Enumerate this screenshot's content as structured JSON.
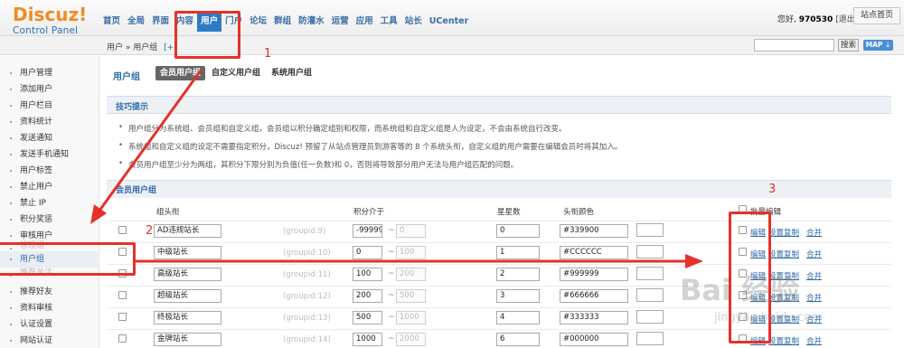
{
  "logo": {
    "title": "Discuz!",
    "subtitle": "Control Panel"
  },
  "nav": [
    "首页",
    "全局",
    "界面",
    "内容",
    "用户",
    "门户",
    "论坛",
    "群组",
    "防灌水",
    "运营",
    "应用",
    "工具",
    "站长",
    "UCenter"
  ],
  "nav_active": "用户",
  "user": {
    "prefix": "您好, ",
    "name": "970530",
    "logout": "[退出]",
    "site_home": "站点首页"
  },
  "breadcrumb": {
    "path": "用户 » 用户组",
    "plus": "[+]"
  },
  "search": {
    "button": "搜索",
    "map": "MAP ⇣"
  },
  "sidebar": [
    "用户管理",
    "添加用户",
    "用户栏目",
    "资料统计",
    "发送通知",
    "发送手机通知",
    "用户标签",
    "禁止用户",
    "禁止 IP",
    "积分奖惩",
    "审核用户",
    "管理组",
    "用户组",
    "推荐关注",
    "推荐好友",
    "资料审核",
    "认证设置",
    "网站认证"
  ],
  "sidebar_active": "用户组",
  "page": {
    "title": "用户组",
    "subtabs": [
      "会员用户组",
      "自定义用户组",
      "系统用户组"
    ],
    "subtab_active": "会员用户组"
  },
  "tips": {
    "head": "技巧提示",
    "items": [
      "用户组分为系统组、会员组和自定义组，会员组以积分确定组别和权限，而系统组和自定义组是人为设定，不会由系统自行改变。",
      "系统组和自定义组的设定不需要指定积分，Discuz! 预留了从站点管理员到游客等的 8 个系统头衔，自定义组的用户需要在编辑会员时将其加入。",
      "会员用户组至少分为两组，其积分下限分别为负值(任一负数)和 0，否则将导致部分用户无法与用户组匹配的问题。"
    ]
  },
  "section": {
    "head": "会员用户组",
    "columns": {
      "title": "组头衔",
      "credits": "积分介于",
      "stars": "星星数",
      "color": "头衔颜色",
      "batch": "批量编辑"
    },
    "rows": [
      {
        "title": "AD违规站长",
        "gid": "(groupid:9)",
        "from": "-99999",
        "to": "0",
        "stars": "0",
        "color": "#339900"
      },
      {
        "title": "中级站长",
        "gid": "(groupid:10)",
        "from": "0",
        "to": "100",
        "stars": "1",
        "color": "#CCCCCC"
      },
      {
        "title": "高级站长",
        "gid": "(groupid:11)",
        "from": "100",
        "to": "200",
        "stars": "2",
        "color": "#999999"
      },
      {
        "title": "超级站长",
        "gid": "(groupid:12)",
        "from": "200",
        "to": "500",
        "stars": "3",
        "color": "#666666"
      },
      {
        "title": "终极站长",
        "gid": "(groupid:13)",
        "from": "500",
        "to": "1000",
        "stars": "4",
        "color": "#333333"
      },
      {
        "title": "金牌站长",
        "gid": "(groupid:14)",
        "from": "1000",
        "to": "2000",
        "stars": "6",
        "color": "#000000"
      }
    ],
    "actions": {
      "edit": "编辑",
      "copy": "设置复制",
      "merge": "合并"
    }
  },
  "annotations": [
    "1",
    "2",
    "3"
  ],
  "watermark": {
    "main": "Bai 经验",
    "sub": "jingyan.baidu.com"
  },
  "colors": {
    "accent": "#2e6aa8",
    "nav_active": "#2d7cc3",
    "annotation": "#e5312a",
    "logo": "#f08c24"
  }
}
